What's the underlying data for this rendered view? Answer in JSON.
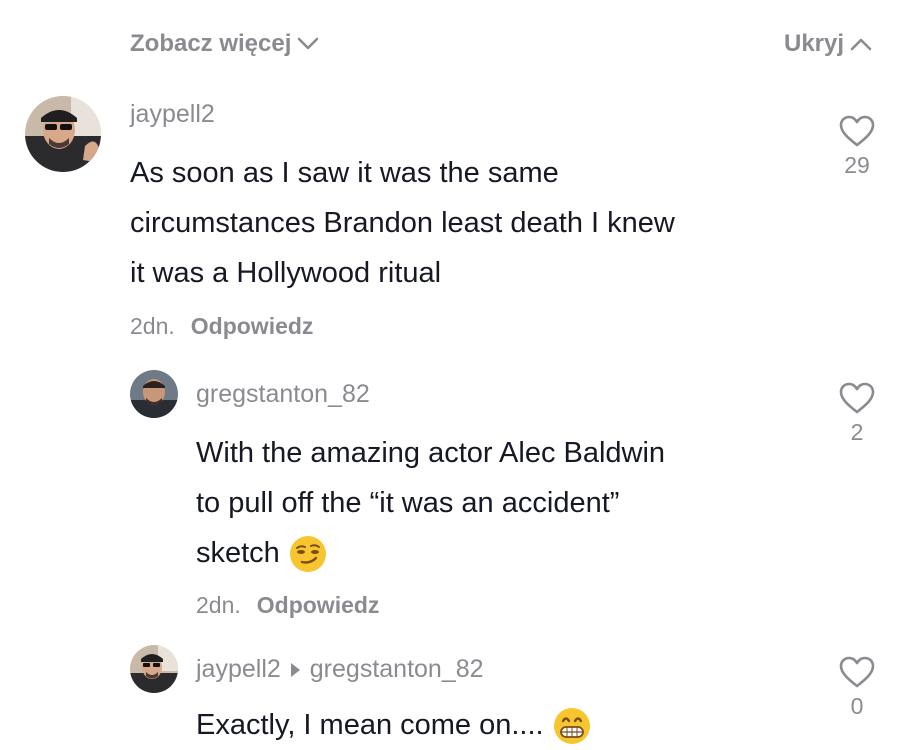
{
  "top": {
    "see_more": "Zobacz więcej",
    "hide": "Ukryj"
  },
  "comments": [
    {
      "username": "jaypell2",
      "text_lines": [
        "As soon as I saw it was the same",
        "circumstances Brandon least death I knew",
        "it was a Hollywood ritual"
      ],
      "time": "2dn.",
      "reply": "Odpowiedz",
      "likes": "29"
    },
    {
      "username": "gregstanton_82",
      "text_lines": [
        "With the amazing actor Alec Baldwin",
        "to pull off the “it was an accident”",
        "sketch"
      ],
      "time": "2dn.",
      "reply": "Odpowiedz",
      "likes": "2",
      "emoji": "smirk-emoji"
    },
    {
      "username": "jaypell2",
      "reply_to": "gregstanton_82",
      "text_lines": [
        "Exactly, I mean come on...."
      ],
      "likes": "0",
      "emoji": "grin-emoji"
    }
  ],
  "colors": {
    "muted": "#8a8b91",
    "text": "#161823",
    "emoji": "#f7c62f"
  }
}
